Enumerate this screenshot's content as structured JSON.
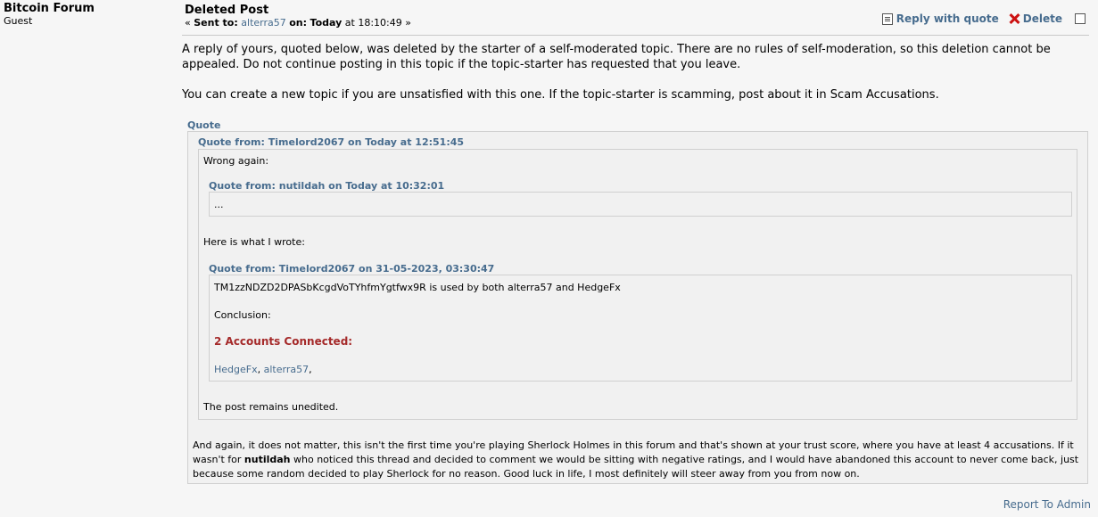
{
  "poster": {
    "name": "Bitcoin Forum",
    "role": "Guest"
  },
  "header": {
    "subject": "Deleted Post",
    "sent_prefix": "« ",
    "sent_to_label": "Sent to:",
    "recipient": "alterra57",
    "on_label": "on:",
    "date": "Today",
    "time": "at 18:10:49 »"
  },
  "actions": {
    "reply": "Reply with quote",
    "delete": "Delete"
  },
  "body": {
    "para1": "A reply of yours, quoted below, was deleted by the starter of a self-moderated topic. There are no rules of self-moderation, so this deletion cannot be appealed. Do not continue posting in this topic if the topic-starter has requested that you leave.",
    "para2": "You can create a new topic if you are unsatisfied with this one. If the topic-starter is scamming, post about it in Scam Accusations."
  },
  "quote": {
    "header": "Quote",
    "q1_title": "Quote from: Timelord2067 on Today at 12:51:45",
    "q1_line1": "Wrong again:",
    "q2_title": "Quote from: nutildah on Today at 10:32:01",
    "q2_text": "...",
    "q1_line2": "Here is what I wrote:",
    "q3_title": "Quote from: Timelord2067 on 31-05-2023, 03:30:47",
    "q3_line1": "TM1zzNDZD2DPASbKcgdVoTYhfmYgtfwx9R is used by both alterra57 and HedgeFx",
    "q3_line2": "Conclusion:",
    "q3_red": "2 Accounts Connected:",
    "q3_link1": "HedgeFx",
    "q3_sep1": ", ",
    "q3_link2": "alterra57",
    "q3_sep2": ",",
    "q1_line3": "The post remains unedited."
  },
  "closing": {
    "pre": "And again, it does not matter, this isn't the first time you're playing Sherlock Holmes in this forum and that's shown at your trust score, where you have at least 4 accusations. If it wasn't for ",
    "bold": "nutildah",
    "post": " who noticed this thread and decided to comment we would be sitting with negative ratings, and I would have abandoned this account to never come back, just because some random decided to play Sherlock for no reason. Good luck in life, I most definitely will steer away from you from now on."
  },
  "footer": {
    "report": "Report To Admin"
  }
}
